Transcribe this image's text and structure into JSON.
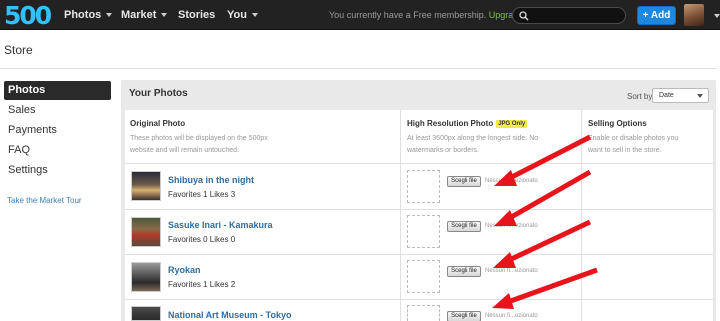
{
  "header": {
    "logo": "500",
    "nav": [
      {
        "label": "Photos",
        "dropdown": true
      },
      {
        "label": "Market",
        "dropdown": true
      },
      {
        "label": "Stories",
        "dropdown": false
      },
      {
        "label": "You",
        "dropdown": true
      }
    ],
    "membership_text": "You currently have a Free membership.",
    "upgrade_link": "Upgrade now",
    "search_icon": "search-icon",
    "add_button": "Add"
  },
  "page": {
    "title": "Store"
  },
  "sidebar": {
    "items": [
      {
        "label": "Photos",
        "active": true
      },
      {
        "label": "Sales",
        "active": false
      },
      {
        "label": "Payments",
        "active": false
      },
      {
        "label": "FAQ",
        "active": false
      },
      {
        "label": "Settings",
        "active": false
      }
    ],
    "tour_link": "Take the Market Tour"
  },
  "main": {
    "title": "Your Photos",
    "sort_label": "Sort by",
    "sort_value": "Date",
    "columns": [
      {
        "heading": "Original Photo",
        "desc_line1": "These photos will be displayed on the 500px",
        "desc_line2": "website and will remain untouched."
      },
      {
        "heading": "High Resolution Photo",
        "badge": "JPG Only",
        "desc_line1": "At least 3600px along the longest side. No",
        "desc_line2": "watermarks or borders."
      },
      {
        "heading": "Selling Options",
        "desc_line1": "Enable or disable photos you",
        "desc_line2": "want to sell in the store."
      }
    ],
    "photos": [
      {
        "title": "Shibuya in the night",
        "stats": "Favorites 1 Likes 3",
        "file_button": "Scegli file",
        "file_status": "Nessun fi...ezionato"
      },
      {
        "title": "Sasuke Inari - Kamakura",
        "stats": "Favorites 0 Likes 0",
        "file_button": "Scegli file",
        "file_status": "Nessun fi...ezionato"
      },
      {
        "title": "Ryokan",
        "stats": "Favorites 1 Likes 2",
        "file_button": "Scegli file",
        "file_status": "Nessun fi...ezionato"
      },
      {
        "title": "National Art Museum - Tokyo",
        "stats": "",
        "file_button": "Scegli file",
        "file_status": "Nessun fi...ezionato"
      }
    ]
  },
  "colors": {
    "topbar": "#222222",
    "brand_blue": "#34bfff",
    "upgrade_green": "#7dc243",
    "add_button": "#1e87e0",
    "link_blue": "#2d6ea3",
    "annotation_arrow": "#e8141b",
    "badge_yellow": "#f2e94e"
  }
}
